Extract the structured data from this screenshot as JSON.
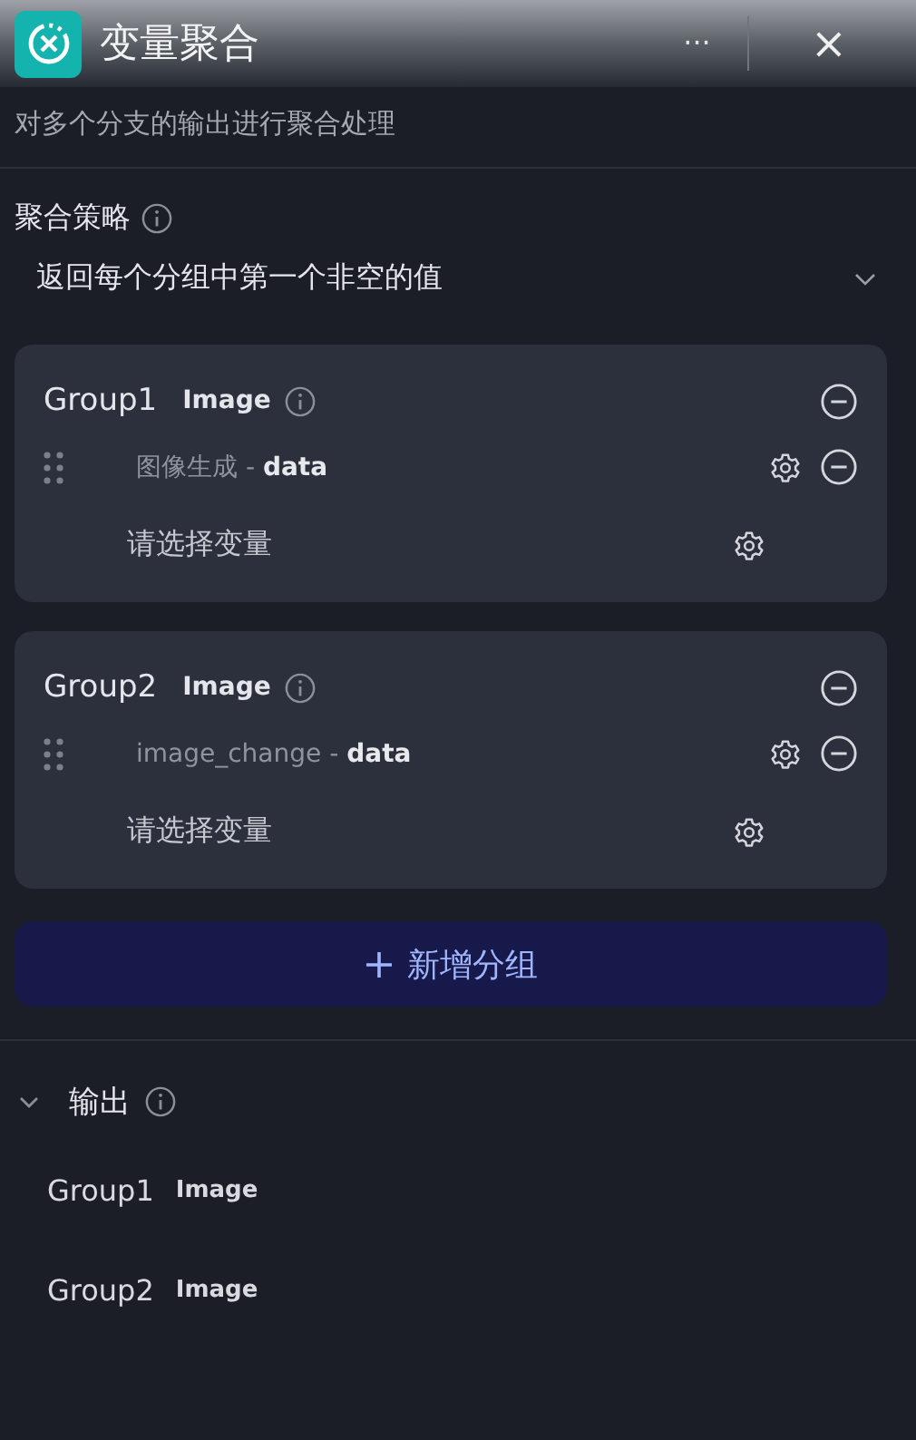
{
  "header": {
    "title": "变量聚合",
    "more": "···",
    "close": "×"
  },
  "description": "对多个分支的输出进行聚合处理",
  "strategy": {
    "label": "聚合策略",
    "value": "返回每个分组中第一个非空的值"
  },
  "groups": [
    {
      "name": "Group1",
      "type": "Image",
      "variables": [
        {
          "kind": "variable",
          "text": "图像生成 - **data**"
        },
        {
          "kind": "empty",
          "placeholder": "请选择变量"
        }
      ]
    },
    {
      "name": "Group2",
      "type": "Image",
      "variables": [
        {
          "kind": "variable",
          "text": "image_change - **data**"
        },
        {
          "kind": "empty",
          "placeholder": "请选择变量"
        }
      ]
    }
  ],
  "add_group": "新增分组",
  "output": {
    "label": "输出",
    "expanded": true,
    "items": [
      {
        "name": "Group1",
        "type": "Image"
      },
      {
        "name": "Group2",
        "type": "Image"
      }
    ]
  }
}
